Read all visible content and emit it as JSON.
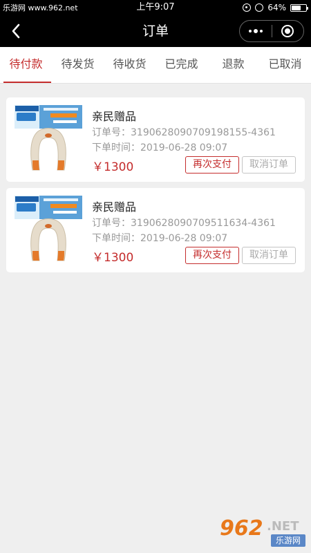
{
  "status_bar": {
    "watermark": "乐游网 www.962.net",
    "time": "上午9:07",
    "battery": "64%",
    "battery_level": 0.64
  },
  "nav": {
    "title": "订单"
  },
  "tabs": [
    {
      "label": "待付款",
      "active": true
    },
    {
      "label": "待发货",
      "active": false
    },
    {
      "label": "待收货",
      "active": false
    },
    {
      "label": "已完成",
      "active": false
    },
    {
      "label": "退款",
      "active": false
    },
    {
      "label": "已取消",
      "active": false
    }
  ],
  "orders": [
    {
      "title": "亲民赠品",
      "order_no_label": "订单号：",
      "order_no": "3190628090709198155-4361",
      "time_label": "下单时间：",
      "time": "2019-06-28 09:07",
      "price": "￥1300",
      "pay_label": "再次支付",
      "cancel_label": "取消订单"
    },
    {
      "title": "亲民赠品",
      "order_no_label": "订单号：",
      "order_no": "3190628090709511634-4361",
      "time_label": "下单时间：",
      "time": "2019-06-28 09:07",
      "price": "￥1300",
      "pay_label": "再次支付",
      "cancel_label": "取消订单"
    }
  ],
  "logo": {
    "number": "962",
    "suffix": ".NET",
    "name": "乐游网"
  },
  "colors": {
    "accent": "#c42c2c",
    "navbar": "#000000",
    "page_bg": "#efefef"
  }
}
